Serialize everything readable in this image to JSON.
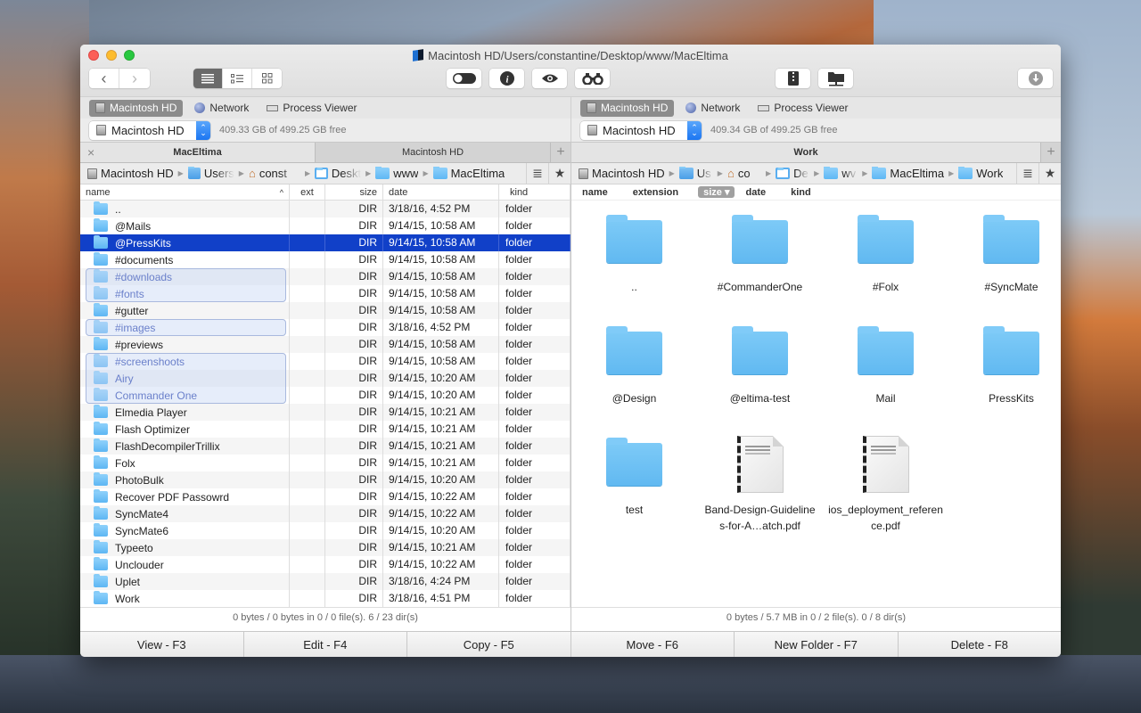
{
  "window": {
    "title": "Macintosh HD/Users/constantine/Desktop/www/MacEltima"
  },
  "toolbar": {
    "back": "‹",
    "forward": "›",
    "view_modes": [
      {
        "name": "list",
        "glyph": "≣"
      },
      {
        "name": "details",
        "glyph": "☷"
      },
      {
        "name": "icons",
        "glyph": "▦"
      }
    ],
    "hidden_toggle": "toggle",
    "info": "i",
    "quick_look": "👁",
    "search": "binoculars",
    "archive": "zip",
    "network_share": "share",
    "download": "⬇"
  },
  "left": {
    "drives": [
      {
        "label": "Macintosh HD",
        "active": true
      },
      {
        "label": "Network"
      },
      {
        "label": "Process Viewer"
      }
    ],
    "volume": {
      "selected": "Macintosh HD",
      "free": "409.33 GB of 499.25 GB free"
    },
    "tabs": [
      {
        "label": "MacEltima",
        "active": true
      },
      {
        "label": "Macintosh HD"
      }
    ],
    "breadcrumb": [
      "Macintosh HD",
      "Users",
      "const",
      "Deskt",
      "www",
      "MacEltima"
    ],
    "columns": {
      "name": "name",
      "ext": "ext",
      "size": "size",
      "date": "date",
      "kind": "kind"
    },
    "rows": [
      {
        "name": "..",
        "size": "DIR",
        "date": "3/18/16, 4:52 PM",
        "kind": "folder"
      },
      {
        "name": "@Mails",
        "size": "DIR",
        "date": "9/14/15, 10:58 AM",
        "kind": "folder"
      },
      {
        "name": "@PressKits",
        "size": "DIR",
        "date": "9/14/15, 10:58 AM",
        "kind": "folder",
        "selected": true
      },
      {
        "name": "#documents",
        "size": "DIR",
        "date": "9/14/15, 10:58 AM",
        "kind": "folder"
      },
      {
        "name": "#downloads",
        "size": "DIR",
        "date": "9/14/15, 10:58 AM",
        "kind": "folder",
        "marked": true
      },
      {
        "name": "#fonts",
        "size": "DIR",
        "date": "9/14/15, 10:58 AM",
        "kind": "folder",
        "marked": true
      },
      {
        "name": "#gutter",
        "size": "DIR",
        "date": "9/14/15, 10:58 AM",
        "kind": "folder"
      },
      {
        "name": "#images",
        "size": "DIR",
        "date": "3/18/16, 4:52 PM",
        "kind": "folder",
        "marked": true
      },
      {
        "name": "#previews",
        "size": "DIR",
        "date": "9/14/15, 10:58 AM",
        "kind": "folder"
      },
      {
        "name": "#screenshoots",
        "size": "DIR",
        "date": "9/14/15, 10:58 AM",
        "kind": "folder",
        "marked": true
      },
      {
        "name": "Airy",
        "size": "DIR",
        "date": "9/14/15, 10:20 AM",
        "kind": "folder",
        "marked": true
      },
      {
        "name": "Commander One",
        "size": "DIR",
        "date": "9/14/15, 10:20 AM",
        "kind": "folder",
        "marked": true
      },
      {
        "name": "Elmedia Player",
        "size": "DIR",
        "date": "9/14/15, 10:21 AM",
        "kind": "folder"
      },
      {
        "name": "Flash Optimizer",
        "size": "DIR",
        "date": "9/14/15, 10:21 AM",
        "kind": "folder"
      },
      {
        "name": "FlashDecompilerTrillix",
        "size": "DIR",
        "date": "9/14/15, 10:21 AM",
        "kind": "folder"
      },
      {
        "name": "Folx",
        "size": "DIR",
        "date": "9/14/15, 10:21 AM",
        "kind": "folder"
      },
      {
        "name": "PhotoBulk",
        "size": "DIR",
        "date": "9/14/15, 10:20 AM",
        "kind": "folder"
      },
      {
        "name": "Recover PDF Passowrd",
        "size": "DIR",
        "date": "9/14/15, 10:22 AM",
        "kind": "folder"
      },
      {
        "name": "SyncMate4",
        "size": "DIR",
        "date": "9/14/15, 10:22 AM",
        "kind": "folder"
      },
      {
        "name": "SyncMate6",
        "size": "DIR",
        "date": "9/14/15, 10:20 AM",
        "kind": "folder"
      },
      {
        "name": "Typeeto",
        "size": "DIR",
        "date": "9/14/15, 10:21 AM",
        "kind": "folder"
      },
      {
        "name": "Unclouder",
        "size": "DIR",
        "date": "9/14/15, 10:22 AM",
        "kind": "folder"
      },
      {
        "name": "Uplet",
        "size": "DIR",
        "date": "3/18/16, 4:24 PM",
        "kind": "folder"
      },
      {
        "name": "Work",
        "size": "DIR",
        "date": "3/18/16, 4:51 PM",
        "kind": "folder"
      }
    ],
    "status": "0 bytes / 0 bytes in 0 / 0 file(s). 6 / 23 dir(s)"
  },
  "right": {
    "drives": [
      {
        "label": "Macintosh HD",
        "active": true
      },
      {
        "label": "Network"
      },
      {
        "label": "Process Viewer"
      }
    ],
    "volume": {
      "selected": "Macintosh HD",
      "free": "409.34 GB of 499.25 GB free"
    },
    "tabs": [
      {
        "label": "Work",
        "active": true
      }
    ],
    "breadcrumb": [
      "Macintosh HD",
      "Us",
      "co",
      "De",
      "wv",
      "MacEltima",
      "Work"
    ],
    "sort_fields": [
      {
        "label": "name"
      },
      {
        "label": "extension"
      },
      {
        "label": "size ▾",
        "active": true
      },
      {
        "label": "date"
      },
      {
        "label": "kind"
      }
    ],
    "items": [
      {
        "name": "..",
        "type": "folder"
      },
      {
        "name": "#CommanderOne",
        "type": "folder"
      },
      {
        "name": "#Folx",
        "type": "folder"
      },
      {
        "name": "#SyncMate",
        "type": "folder"
      },
      {
        "name": "@Design",
        "type": "folder"
      },
      {
        "name": "@eltima-test",
        "type": "folder"
      },
      {
        "name": "Mail",
        "type": "folder"
      },
      {
        "name": "PressKits",
        "type": "folder"
      },
      {
        "name": "test",
        "type": "folder"
      },
      {
        "name": "Band-Design-Guidelines-for-A…atch.pdf",
        "type": "pdf"
      },
      {
        "name": "ios_deployment_reference.pdf",
        "type": "pdf"
      }
    ],
    "status": "0 bytes / 5.7 MB in 0 / 2 file(s). 0 / 8 dir(s)"
  },
  "function_keys": [
    "View - F3",
    "Edit - F4",
    "Copy - F5",
    "Move - F6",
    "New Folder - F7",
    "Delete - F8"
  ]
}
